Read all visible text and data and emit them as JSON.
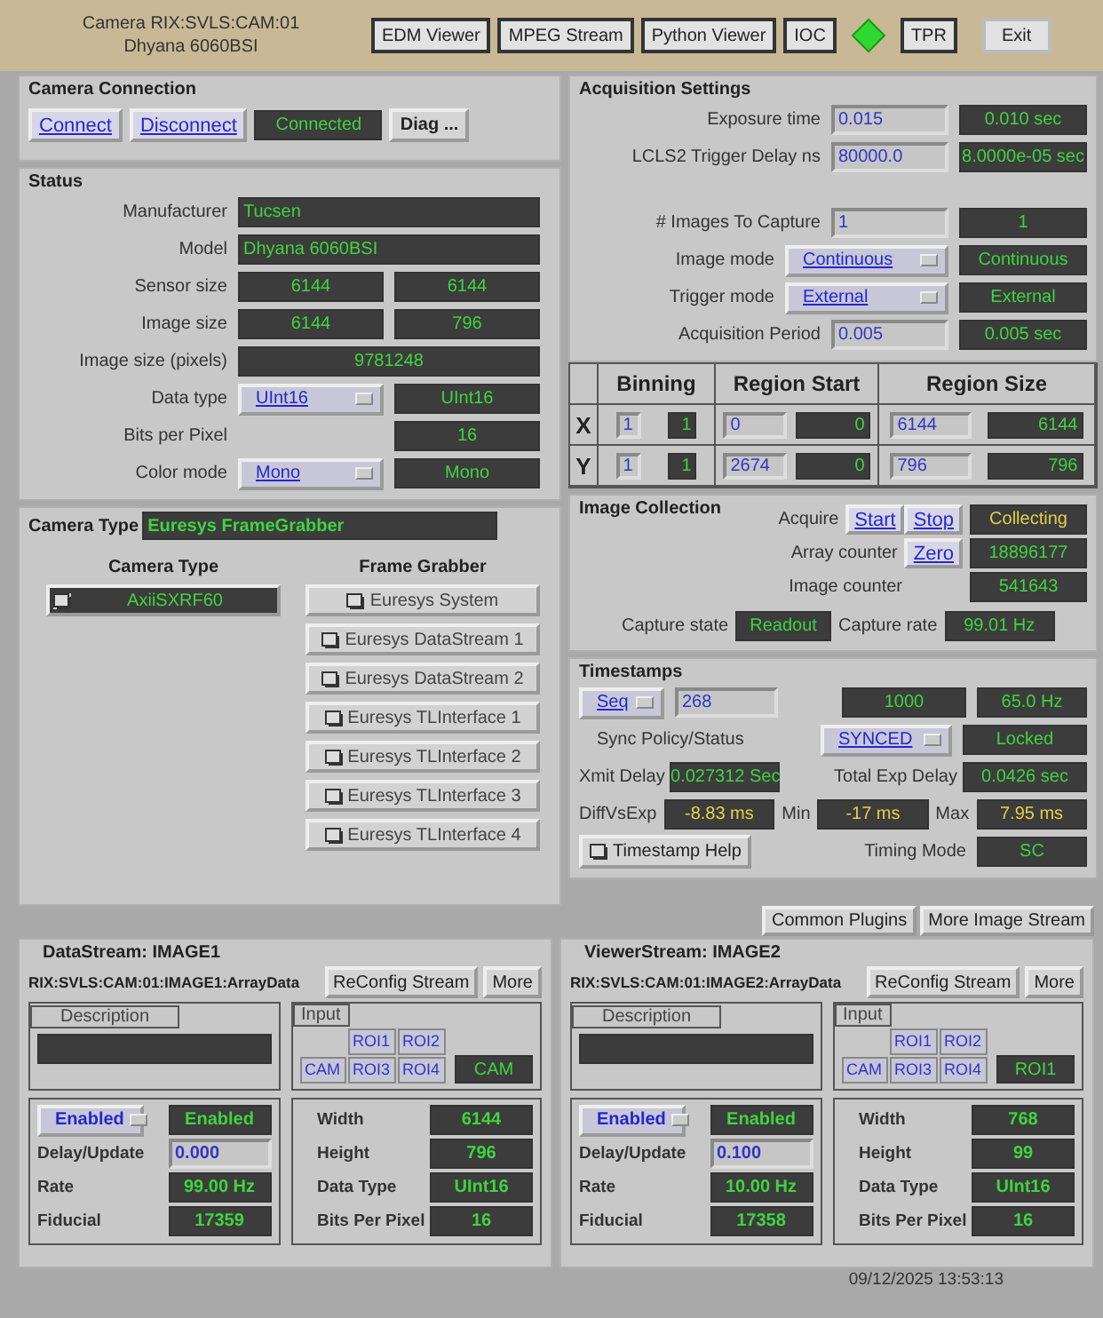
{
  "header": {
    "title": "Camera RIX:SVLS:CAM:01",
    "subtitle": "Dhyana 6060BSI",
    "items": [
      {
        "kind": "button",
        "label": "EDM Viewer"
      },
      {
        "kind": "button",
        "label": "MPEG Stream"
      },
      {
        "kind": "button",
        "label": "Python Viewer"
      },
      {
        "kind": "button",
        "label": "IOC"
      },
      {
        "kind": "indicator"
      },
      {
        "kind": "button",
        "label": "TPR"
      },
      {
        "kind": "button",
        "label": "Exit"
      }
    ]
  },
  "camera_connection": {
    "title": "Camera Connection",
    "buttons": [
      "Connect",
      "Disconnect"
    ],
    "status": "Connected",
    "diag": "Diag ..."
  },
  "status": {
    "title": "Status",
    "rows": [
      {
        "label": "Manufacturer",
        "cells": [
          {
            "kind": "wide-left",
            "text": "Tucsen"
          }
        ]
      },
      {
        "label": "Model",
        "cells": [
          {
            "kind": "wide-left",
            "text": "Dhyana 6060BSI"
          }
        ]
      },
      {
        "label": "Sensor size",
        "cells": [
          {
            "kind": "readback",
            "text": "6144"
          },
          {
            "kind": "readback",
            "text": "6144"
          }
        ]
      },
      {
        "label": "Image size",
        "cells": [
          {
            "kind": "readback",
            "text": "6144"
          },
          {
            "kind": "readback",
            "text": "796"
          }
        ]
      },
      {
        "label": "Image size (pixels)",
        "cells": [
          {
            "kind": "wide",
            "text": "9781248"
          }
        ]
      },
      {
        "label": "Data type",
        "cells": [
          {
            "kind": "menu",
            "text": "UInt16"
          },
          {
            "kind": "readback",
            "text": "UInt16"
          }
        ]
      },
      {
        "label": "Bits per Pixel",
        "cells": [
          {
            "kind": "empty"
          },
          {
            "kind": "readback",
            "text": "16"
          }
        ]
      },
      {
        "label": "Color mode",
        "cells": [
          {
            "kind": "menu",
            "text": "Mono"
          },
          {
            "kind": "readback",
            "text": "Mono"
          }
        ]
      }
    ]
  },
  "camera_type": {
    "label": "Camera Type",
    "value": "Euresys FrameGrabber",
    "camera_heading": "Camera Type",
    "grabber_heading": "Frame Grabber",
    "cameras": [
      "AxiiSXRF60"
    ],
    "grabbers": [
      "Euresys System",
      "Euresys DataStream 1",
      "Euresys DataStream 2",
      "Euresys TLInterface 1",
      "Euresys TLInterface 2",
      "Euresys TLInterface 3",
      "Euresys TLInterface 4"
    ]
  },
  "acquisition": {
    "title": "Acquisition Settings",
    "groups": [
      [
        {
          "label": "Exposure time",
          "cells": [
            {
              "kind": "input",
              "text": "0.015"
            },
            {
              "kind": "readback",
              "text": "0.010 sec"
            }
          ]
        },
        {
          "label": "LCLS2 Trigger Delay ns",
          "cells": [
            {
              "kind": "input",
              "text": "80000.0"
            },
            {
              "kind": "readback",
              "text": "8.0000e-05 sec"
            }
          ]
        }
      ],
      [
        {
          "label": "# Images To Capture",
          "cells": [
            {
              "kind": "input",
              "text": "1"
            },
            {
              "kind": "readback",
              "text": "1"
            }
          ]
        },
        {
          "label": "Image mode",
          "cells": [
            {
              "kind": "menu",
              "text": "Continuous"
            },
            {
              "kind": "readback",
              "text": "Continuous"
            }
          ]
        },
        {
          "label": "Trigger mode",
          "cells": [
            {
              "kind": "menu",
              "text": "External"
            },
            {
              "kind": "readback",
              "text": "External"
            }
          ]
        },
        {
          "label": "Acquisition Period",
          "cells": [
            {
              "kind": "input",
              "text": "0.005"
            },
            {
              "kind": "readback",
              "text": "0.005 sec"
            }
          ]
        }
      ]
    ]
  },
  "roi_table": {
    "columns": [
      "Binning",
      "Region Start",
      "Region Size"
    ],
    "rows": [
      {
        "axis": "X",
        "binning": [
          "1",
          "1"
        ],
        "start": [
          "0",
          "0"
        ],
        "size": [
          "6144",
          "6144"
        ]
      },
      {
        "axis": "Y",
        "binning": [
          "1",
          "1"
        ],
        "start": [
          "2674",
          "0"
        ],
        "size": [
          "796",
          "796"
        ]
      }
    ]
  },
  "image_collection": {
    "title": "Image Collection",
    "acquire_label": "Acquire",
    "start": "Start",
    "stop": "Stop",
    "acquire_status": {
      "text": "Collecting",
      "alarm": true
    },
    "array_counter_label": "Array counter",
    "zero": "Zero",
    "array_counter": "18896177",
    "image_counter_label": "Image counter",
    "image_counter": "541643",
    "capture_state_label": "Capture state",
    "capture_state": "Readout",
    "capture_rate_label": "Capture rate",
    "capture_rate": "99.01 Hz"
  },
  "timestamps": {
    "title": "Timestamps",
    "mode": "Seq",
    "code": "268",
    "count": "1000",
    "rate": "65.0 Hz",
    "sync_label": "Sync Policy/Status",
    "sync": "SYNCED",
    "sync_status": "Locked",
    "xmit_label": "Xmit Delay",
    "xmit": "0.027312 Sec",
    "total_label": "Total Exp Delay",
    "total": "0.0426 sec",
    "diff_label": "DiffVsExp",
    "diff": {
      "text": "-8.83 ms",
      "alarm": true
    },
    "min_label": "Min",
    "min": {
      "text": "-17 ms",
      "alarm": true
    },
    "max_label": "Max",
    "max": {
      "text": "7.95 ms",
      "alarm": true
    },
    "help": "Timestamp Help",
    "timing_label": "Timing Mode",
    "timing": "SC"
  },
  "plugin_buttons": [
    "Common Plugins",
    "More Image Stream"
  ],
  "streams": [
    {
      "title": "DataStream: IMAGE1",
      "pv": "RIX:SVLS:CAM:01:IMAGE1:ArrayData",
      "buttons": [
        "ReConfig Stream",
        "More"
      ],
      "description_label": "Description",
      "input_label": "Input",
      "inputs": [
        "ROI1",
        "ROI2",
        "CAM",
        "ROI3",
        "ROI4"
      ],
      "input_readback": "CAM",
      "enable": "Enabled",
      "enable_status": "Enabled",
      "delay_label": "Delay/Update",
      "delay": "0.000",
      "rate_label": "Rate",
      "rate": "99.00 Hz",
      "fiducial_label": "Fiducial",
      "fiducial": "17359",
      "stats": [
        {
          "label": "Width",
          "value": "6144"
        },
        {
          "label": "Height",
          "value": "796"
        },
        {
          "label": "Data Type",
          "value": "UInt16"
        },
        {
          "label": "Bits Per Pixel",
          "value": "16"
        }
      ]
    },
    {
      "title": "ViewerStream: IMAGE2",
      "pv": "RIX:SVLS:CAM:01:IMAGE2:ArrayData",
      "buttons": [
        "ReConfig Stream",
        "More"
      ],
      "description_label": "Description",
      "input_label": "Input",
      "inputs": [
        "ROI1",
        "ROI2",
        "CAM",
        "ROI3",
        "ROI4"
      ],
      "input_readback": "ROI1",
      "enable": "Enabled",
      "enable_status": "Enabled",
      "delay_label": "Delay/Update",
      "delay": "0.100",
      "rate_label": "Rate",
      "rate": "10.00 Hz",
      "fiducial_label": "Fiducial",
      "fiducial": "17358",
      "stats": [
        {
          "label": "Width",
          "value": "768"
        },
        {
          "label": "Height",
          "value": "99"
        },
        {
          "label": "Data Type",
          "value": "UInt16"
        },
        {
          "label": "Bits Per Pixel",
          "value": "16"
        }
      ]
    }
  ],
  "footer": {
    "timestamp": "09/12/2025 13:53:13"
  }
}
